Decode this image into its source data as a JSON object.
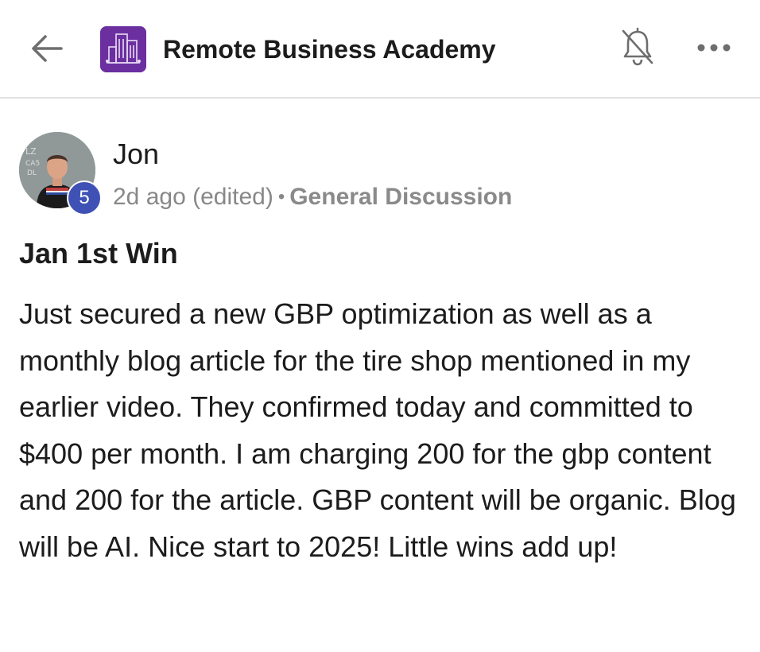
{
  "header": {
    "title": "Remote Business Academy",
    "back_icon": "arrow-left-icon",
    "logo_icon": "city-buildings-logo",
    "bell_icon": "bell-off-icon",
    "more_icon": "more-horizontal-icon",
    "logo_color": "#6b2fa0"
  },
  "post": {
    "author": {
      "name": "Jon",
      "level": "5",
      "badge_color": "#3f51b5"
    },
    "time": "2d ago (edited)",
    "separator": "•",
    "category": "General Discussion",
    "title": "Jan 1st Win",
    "body": "Just secured a new GBP optimization as well as a monthly blog article for the tire shop mentioned in my earlier video. They confirmed today and committed to $400 per month. I am charging 200 for the gbp content and 200 for the article. GBP content will be organic. Blog will be AI. Nice start to 2025! Little wins add up!"
  }
}
